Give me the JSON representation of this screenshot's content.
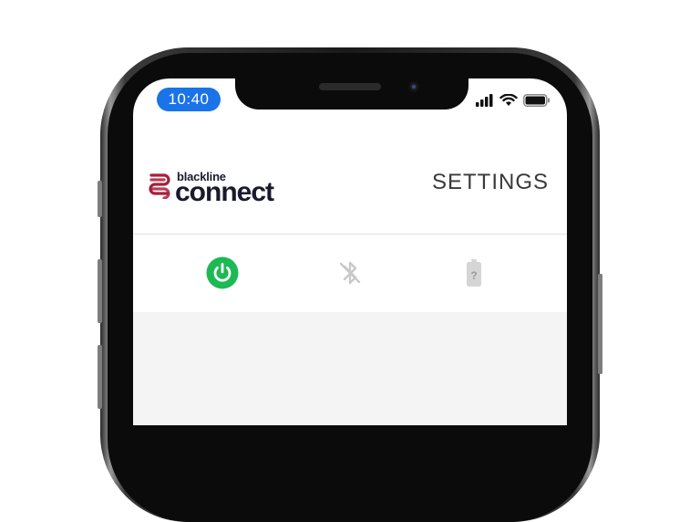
{
  "status_bar": {
    "time": "10:40"
  },
  "app": {
    "logo": {
      "small_text": "blackline",
      "big_text": "connect"
    },
    "settings_label": "SETTINGS",
    "status_icons": [
      {
        "name": "power-icon",
        "state": "on",
        "color": "#1db954"
      },
      {
        "name": "bluetooth-icon",
        "state": "disabled",
        "color": "#c9c9c9"
      },
      {
        "name": "battery-unknown-icon",
        "state": "unknown",
        "color": "#d5d5d5"
      }
    ]
  },
  "colors": {
    "time_pill": "#1a73e8",
    "logo_red": "#a81e3c",
    "logo_text": "#1a1a2e",
    "power_green": "#1db954"
  }
}
